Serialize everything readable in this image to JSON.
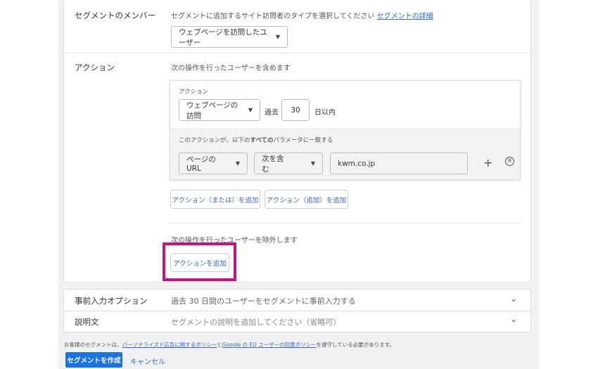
{
  "segment_members": {
    "label": "セグメントのメンバー",
    "description": "セグメントに追加するサイト訪問者のタイプを選択してください",
    "details_link": "セグメントの詳細",
    "selected": "ウェブページを訪問したユーザー"
  },
  "action": {
    "label": "アクション",
    "include_text": "次の操作を行ったユーザーを含めます",
    "box_title": "アクション",
    "event_select": "ウェブページの訪問",
    "past_label": "過去",
    "days_value": "30",
    "days_suffix": "日以内",
    "param_prefix": "このアクションが、以下の",
    "param_bold": "すべての",
    "param_suffix": "パラメータに一致する",
    "param_field": "ページの URL",
    "param_operator": "次を含む",
    "param_value": "kwm.co.jp",
    "add_or_button": "アクション（または）を追加",
    "add_and_button": "アクション（追加）を追加",
    "exclude_text": "次の操作を行ったユーザーを除外します",
    "add_exclude_button": "アクションを追加"
  },
  "prefill": {
    "label": "事前入力オプション",
    "text": "過去 30 日間のユーザーをセグメントに事前入力する"
  },
  "description_row": {
    "label": "説明文",
    "text": "セグメントの説明を追加してください（省略可）"
  },
  "footer": {
    "policy_prefix": "お客様のセグメントは、",
    "policy_link1": "パーソナライズド広告に関するポリシー",
    "policy_and": "と",
    "policy_link2": "Google の EU ユーザーの同意ポリシー",
    "policy_suffix": "を遵守している必要があります。",
    "create_button": "セグメントを作成",
    "cancel_button": "キャンセル"
  },
  "colors": {
    "primary": "#1a73e8",
    "link": "#3367d6",
    "highlight": "#c8127f"
  },
  "icons": [
    "chevron-down-icon",
    "plus-icon",
    "remove-circle-icon"
  ]
}
